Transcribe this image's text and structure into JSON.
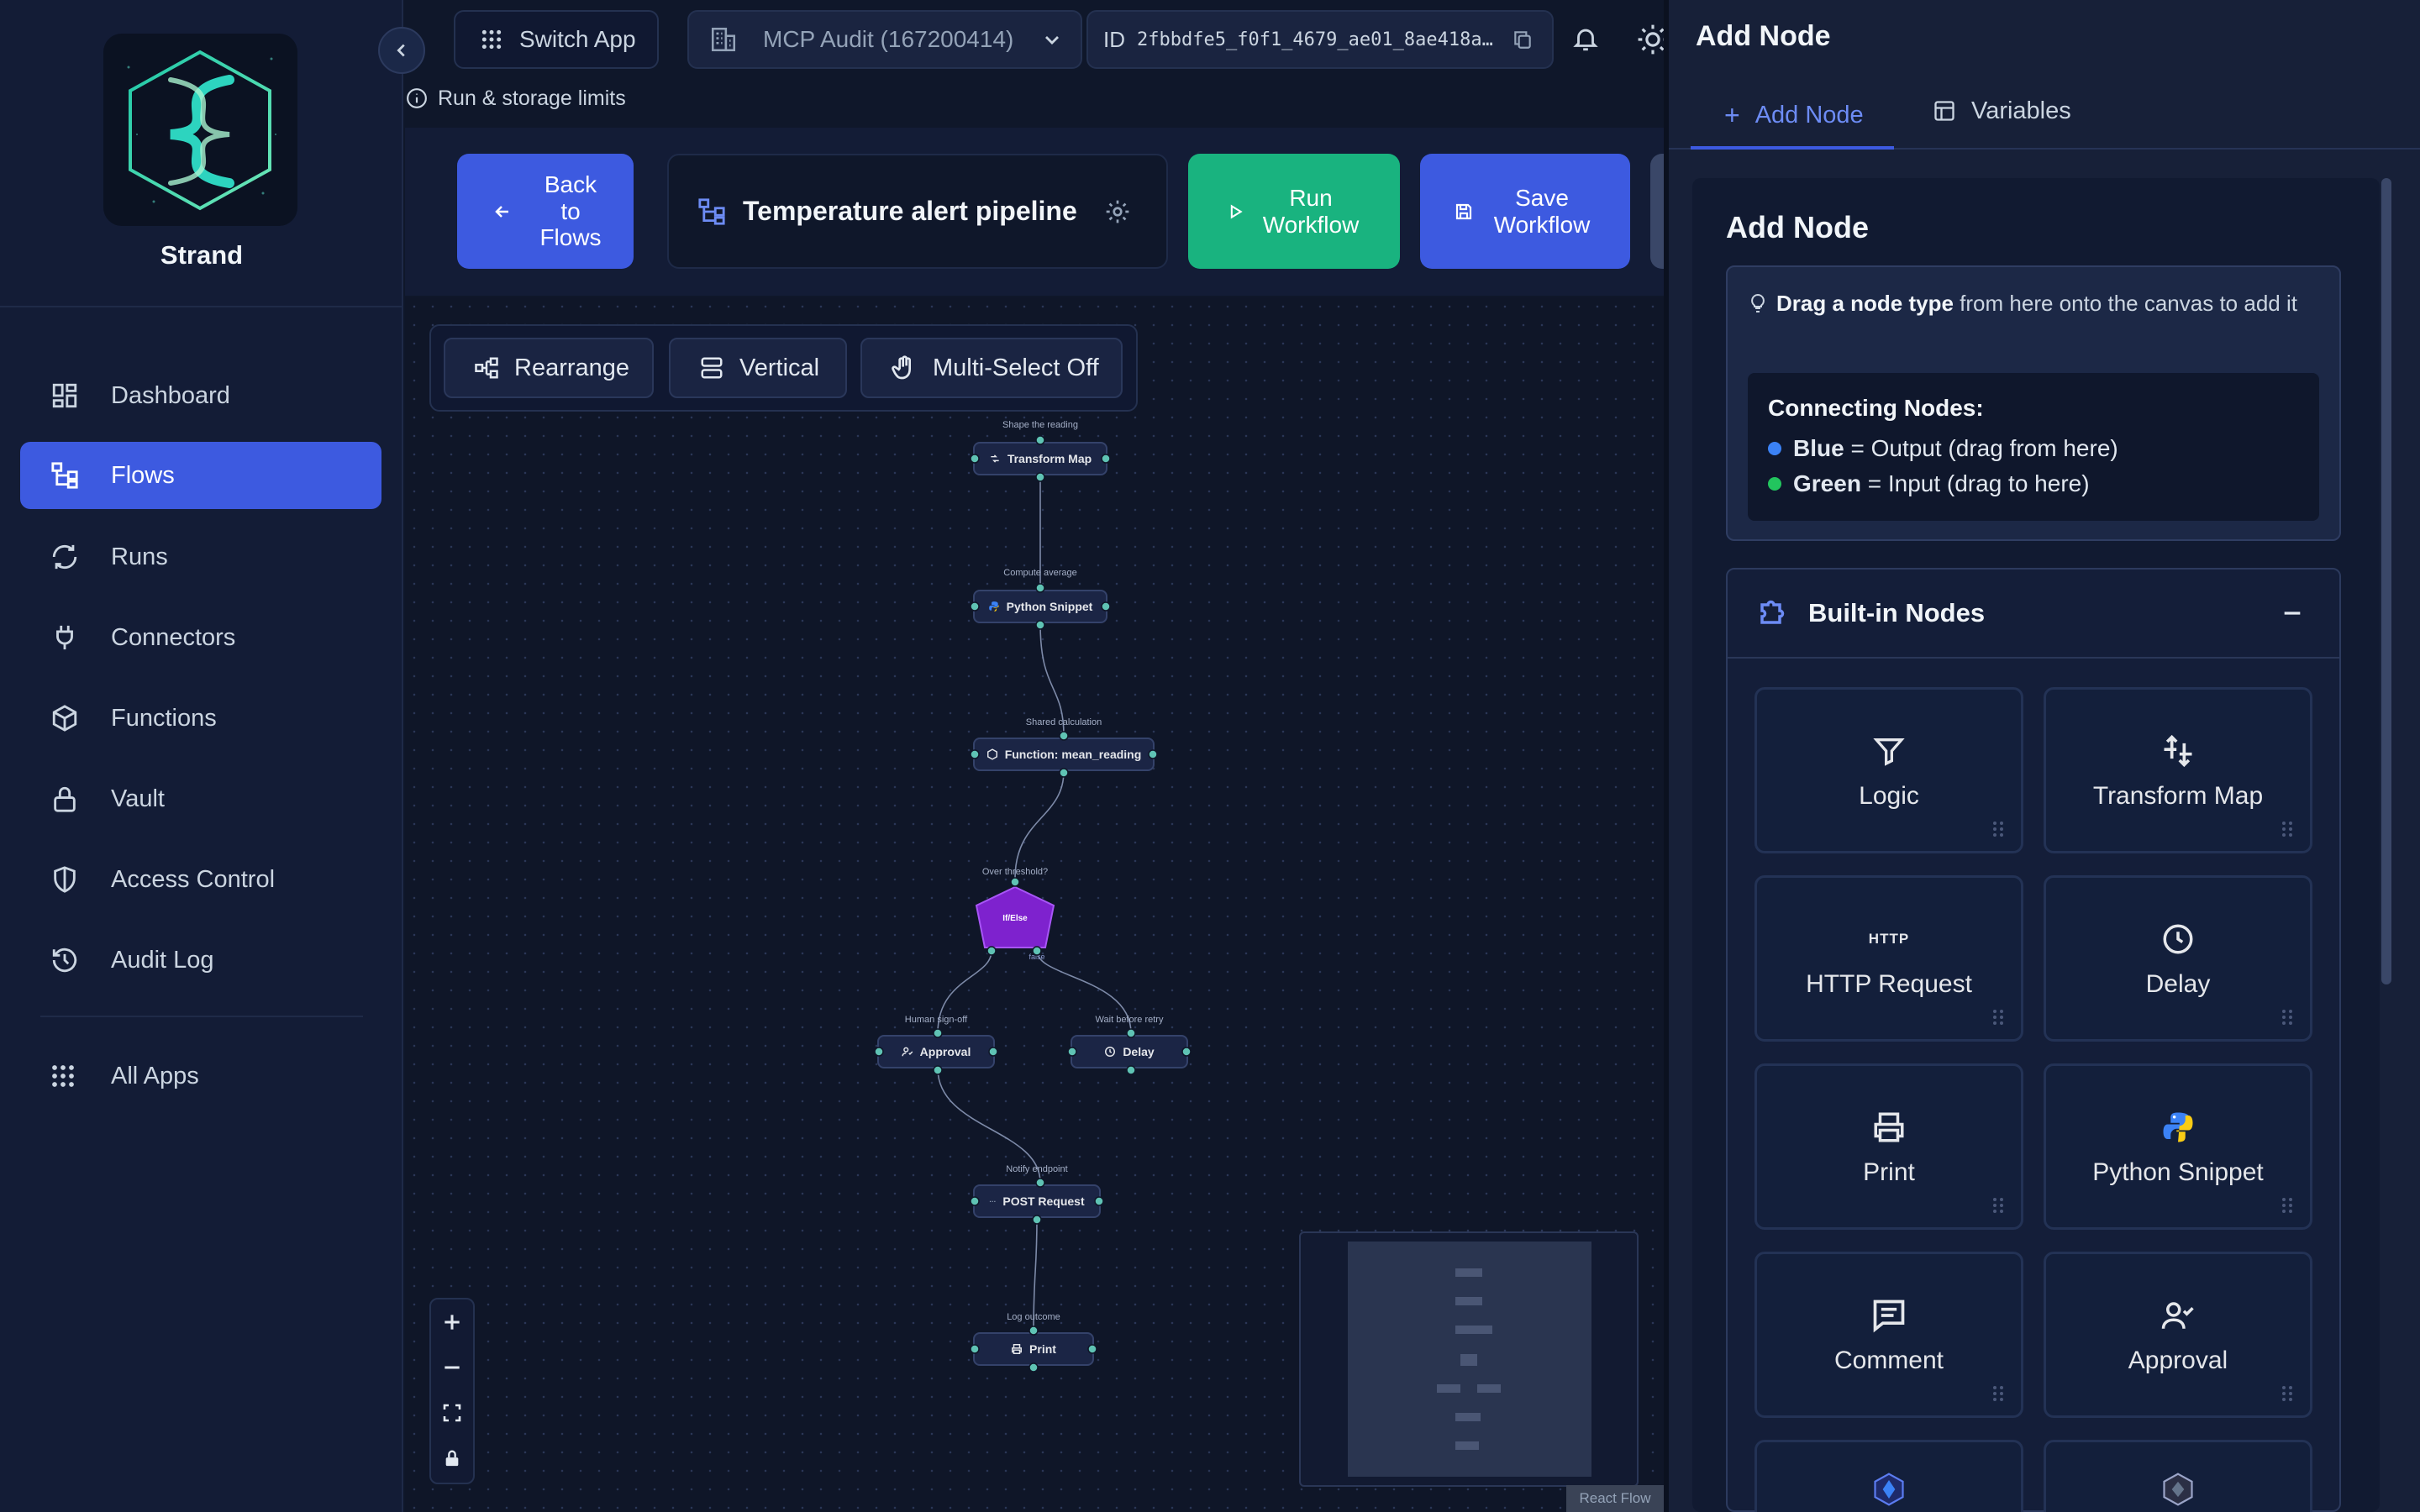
{
  "app": {
    "name": "Strand"
  },
  "sidebar": {
    "items": [
      {
        "label": "Dashboard",
        "icon": "dashboard-icon",
        "active": false
      },
      {
        "label": "Flows",
        "icon": "flows-icon",
        "active": true
      },
      {
        "label": "Runs",
        "icon": "runs-icon",
        "active": false
      },
      {
        "label": "Connectors",
        "icon": "plug-icon",
        "active": false
      },
      {
        "label": "Functions",
        "icon": "cube-icon",
        "active": false
      },
      {
        "label": "Vault",
        "icon": "lock-icon",
        "active": false
      },
      {
        "label": "Access Control",
        "icon": "shield-icon",
        "active": false
      },
      {
        "label": "Audit Log",
        "icon": "history-icon",
        "active": false
      },
      {
        "label": "All Apps",
        "icon": "grid-icon",
        "active": false
      }
    ]
  },
  "topbar": {
    "switch_app": "Switch App",
    "org": "MCP Audit (167200414)",
    "id_label": "ID",
    "id_value": "2fbbdfe5_f0f1_4679_ae01_8ae418a…",
    "limits": "Run & storage limits"
  },
  "header": {
    "back_label": "Back to Flows",
    "flow_name": "Temperature alert pipeline",
    "run_label": "Run Workflow",
    "save_label": "Save Workflow"
  },
  "canvas": {
    "toolbar": {
      "rearrange": "Rearrange",
      "vertical": "Vertical",
      "multiselect": "Multi-Select Off"
    },
    "nodes": [
      {
        "label": "Shape the reading",
        "title": "Transform Map"
      },
      {
        "label": "Compute average",
        "title": "Python Snippet"
      },
      {
        "label": "Shared calculation",
        "title": "Function: mean_reading"
      },
      {
        "label": "Over threshold?",
        "title": "If/Else",
        "branch_label": "false"
      },
      {
        "label": "Human sign-off",
        "title": "Approval"
      },
      {
        "label": "Wait before retry",
        "title": "Delay"
      },
      {
        "label": "Notify endpoint",
        "title": "POST Request"
      },
      {
        "label": "Log outcome",
        "title": "Print"
      }
    ],
    "attribution": "React Flow"
  },
  "panel": {
    "title": "Add Node",
    "tabs": [
      {
        "label": "Add Node",
        "active": true
      },
      {
        "label": "Variables",
        "active": false
      }
    ],
    "section_title": "Add Node",
    "tip_bold": "Drag a node type",
    "tip_rest": "from here onto the canvas to add it",
    "connecting_title": "Connecting Nodes:",
    "blue_bold": "Blue",
    "blue_rest": "= Output (drag from here)",
    "green_bold": "Green",
    "green_rest": "= Input (drag to here)",
    "builtin_title": "Built-in Nodes",
    "tiles": [
      {
        "label": "Logic",
        "icon": "filter-icon"
      },
      {
        "label": "Transform Map",
        "icon": "transform-icon"
      },
      {
        "label": "HTTP Request",
        "icon": "http-icon",
        "icon_text": "HTTP"
      },
      {
        "label": "Delay",
        "icon": "clock-icon"
      },
      {
        "label": "Print",
        "icon": "printer-icon"
      },
      {
        "label": "Python Snippet",
        "icon": "python-icon"
      },
      {
        "label": "Comment",
        "icon": "comment-icon"
      },
      {
        "label": "Approval",
        "icon": "approval-icon"
      }
    ]
  },
  "colors": {
    "accent": "#3d5ae0",
    "run_green": "#19b37f",
    "ifelse_purple": "#7e22ce",
    "output_blue": "#3b82f6",
    "input_green": "#22c55e"
  }
}
